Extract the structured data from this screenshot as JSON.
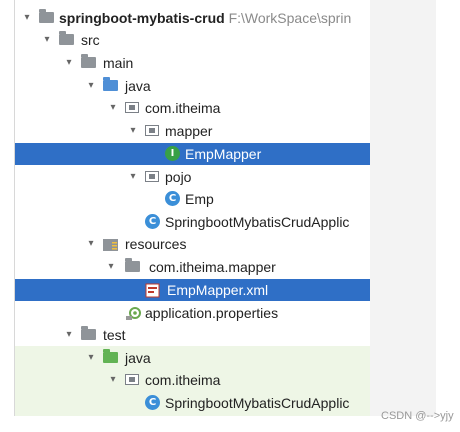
{
  "tree": {
    "project": {
      "name": "springboot-mybatis-crud",
      "path": "F:\\WorkSpace\\sprin"
    },
    "src": "src",
    "main": "main",
    "java": "java",
    "pkg_main": "com.itheima",
    "mapper_pkg": "mapper",
    "emp_mapper": "EmpMapper",
    "pojo_pkg": "pojo",
    "emp": "Emp",
    "app_class": "SpringbootMybatisCrudApplic",
    "resources": "resources",
    "res_pkg": "com.itheima.mapper",
    "emp_mapper_xml": "EmpMapper.xml",
    "app_props": "application.properties",
    "test": "test",
    "test_java": "java",
    "test_pkg": "com.itheima",
    "test_app_class": "SpringbootMybatisCrudApplic"
  },
  "icons": {
    "project_folder": "folder-icon",
    "source_folder": "source-folder-icon",
    "test_folder": "test-folder-icon",
    "package": "package-icon",
    "interface": "interface-icon",
    "class": "class-icon",
    "spring_app": "spring-boot-class-icon",
    "resources": "resources-folder-icon",
    "xml": "mybatis-xml-icon",
    "properties": "properties-icon"
  },
  "colors": {
    "selection": "#2f6fc6",
    "test_background": "#eef6e6",
    "folder_blue": "#4f8fd6",
    "folder_green": "#62b354",
    "interface_green": "#38a046"
  },
  "watermark": "CSDN @-->yjy"
}
